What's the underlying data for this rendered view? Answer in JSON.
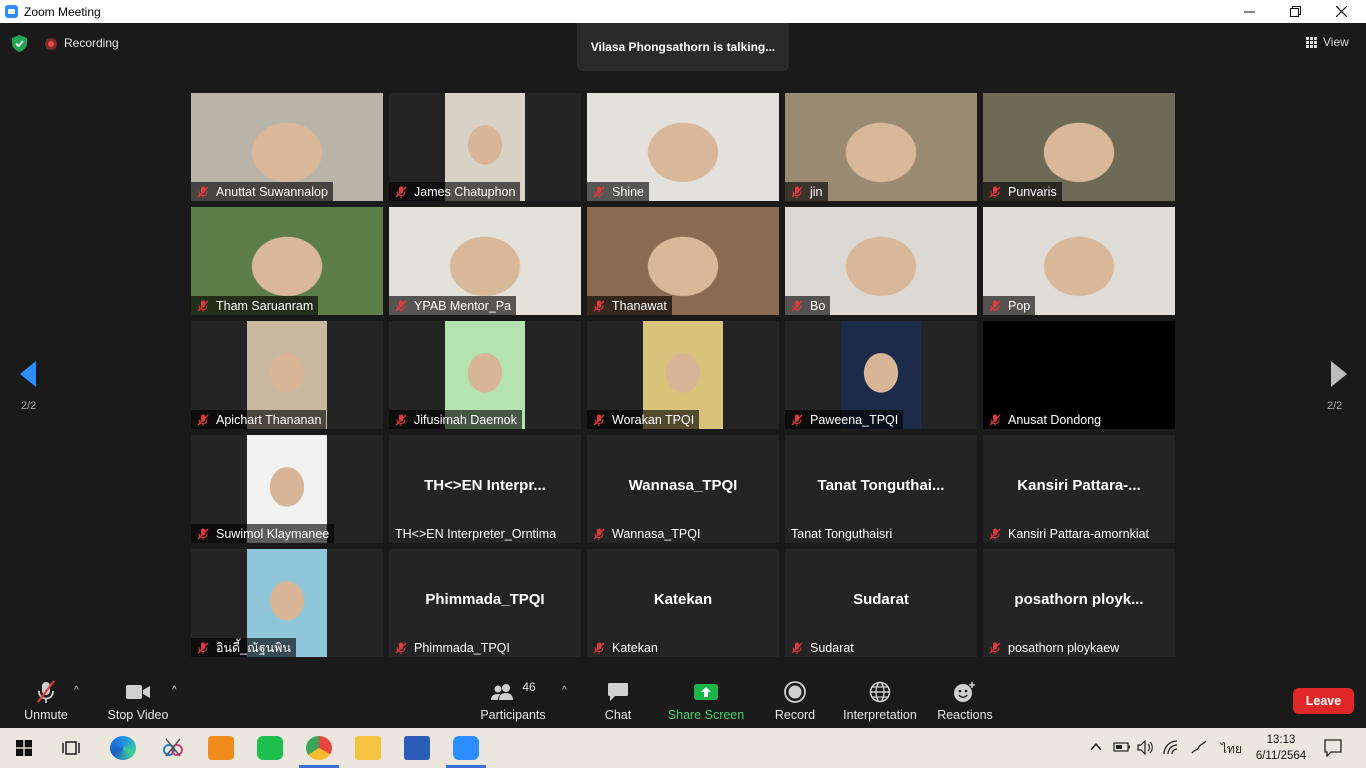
{
  "window": {
    "title": "Zoom Meeting"
  },
  "topbar": {
    "recording_label": "Recording",
    "talking": "Vilasa Phongsathorn is talking...",
    "view_label": "View"
  },
  "gallery": {
    "page_indicator_left": "2/2",
    "page_indicator_right": "2/2",
    "tiles": [
      {
        "name": "Anuttat Suwannalop",
        "muted": true,
        "video": "on",
        "bg": "#b9b4a8"
      },
      {
        "name": "James Chatuphon",
        "muted": true,
        "video": "portrait",
        "bg": "#d8d2c6"
      },
      {
        "name": "Shine",
        "muted": true,
        "video": "on",
        "bg": "#e3e1dc"
      },
      {
        "name": "jin",
        "muted": true,
        "video": "on",
        "bg": "#9b8a72"
      },
      {
        "name": "Punvaris",
        "muted": true,
        "video": "on",
        "bg": "#6e6a55"
      },
      {
        "name": "Tham Saruanram",
        "muted": true,
        "video": "on",
        "bg": "#5c7d45"
      },
      {
        "name": "YPAB Mentor_Pa",
        "muted": true,
        "video": "on",
        "bg": "#e4e0da"
      },
      {
        "name": "Thanawat",
        "muted": true,
        "video": "on",
        "bg": "#8a6a50"
      },
      {
        "name": "Bo",
        "muted": true,
        "video": "on",
        "bg": "#dcd9d4"
      },
      {
        "name": "Pop",
        "muted": true,
        "video": "on",
        "bg": "#e0ddd8"
      },
      {
        "name": "Apichart Thananan",
        "muted": true,
        "video": "portrait",
        "bg": "#c8b8a0"
      },
      {
        "name": "Jifusimah  Daemok",
        "muted": true,
        "video": "portrait",
        "bg": "#b5e3b0"
      },
      {
        "name": "Worakan TPQI",
        "muted": true,
        "video": "portrait",
        "bg": "#d9c27a"
      },
      {
        "name": "Paweena_TPQI",
        "muted": true,
        "video": "portrait",
        "bg": "#1c2b4a"
      },
      {
        "name": "Anusat Dondong",
        "muted": true,
        "video": "black",
        "bg": "#000000"
      },
      {
        "name": "Suwimol Klaymanee",
        "muted": true,
        "video": "portrait",
        "bg": "#f2f2f2"
      },
      {
        "name": "TH<>EN Interpreter_Orntima",
        "center": "TH<>EN  Interpr...",
        "muted": false,
        "video": "off"
      },
      {
        "name": "Wannasa_TPQI",
        "center": "Wannasa_TPQI",
        "muted": true,
        "video": "off"
      },
      {
        "name": "Tanat Tonguthaisri",
        "center": "Tanat  Tonguthai...",
        "muted": false,
        "video": "off"
      },
      {
        "name": "Kansiri Pattara-amornkiat",
        "center": "Kansiri  Pattara-...",
        "muted": true,
        "video": "off"
      },
      {
        "name": "อินดี้_ณัฐนพิน",
        "muted": true,
        "video": "portrait",
        "bg": "#8fc6d9"
      },
      {
        "name": "Phimmada_TPQI",
        "center": "Phimmada_TPQI",
        "muted": true,
        "video": "off"
      },
      {
        "name": "Katekan",
        "center": "Katekan",
        "muted": true,
        "video": "off"
      },
      {
        "name": "Sudarat",
        "center": "Sudarat",
        "muted": true,
        "video": "off"
      },
      {
        "name": "posathorn ploykaew",
        "center": "posathorn  ployk...",
        "muted": true,
        "video": "off"
      }
    ]
  },
  "toolbar": {
    "unmute": "Unmute",
    "stop_video": "Stop Video",
    "participants": "Participants",
    "participants_count": "46",
    "chat": "Chat",
    "share_screen": "Share Screen",
    "record": "Record",
    "interpretation": "Interpretation",
    "reactions": "Reactions",
    "leave": "Leave"
  },
  "taskbar": {
    "language": "ไทย",
    "time": "13:13",
    "date": "6/11/2564"
  },
  "colors": {
    "background": "#1a1a1a",
    "tile": "#242424",
    "muted_icon": "#e0393e",
    "share_green": "#1bb34a",
    "leave_red": "#e02828",
    "accent_blue": "#2d8cff"
  }
}
